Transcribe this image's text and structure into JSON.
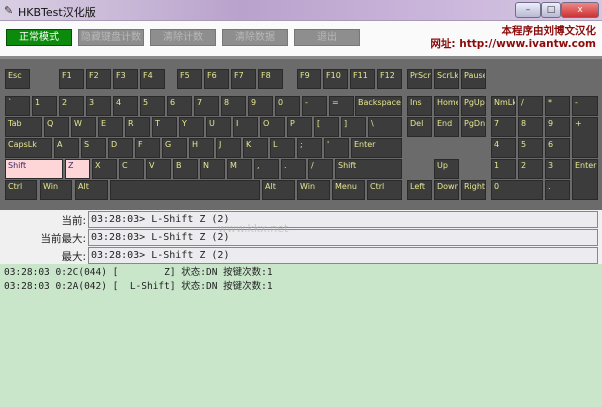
{
  "window": {
    "title": "HKBTest汉化版",
    "minimize": "–",
    "maximize": "□",
    "close": "x"
  },
  "toolbar": {
    "buttons": [
      "正常模式",
      "隐藏键盘计数",
      "清除计数",
      "清除数据",
      "退出"
    ],
    "credit_line1": "本程序由刘博文汉化",
    "credit_line2": "网址: http://www.ivantw.com"
  },
  "keyboard": {
    "pressed": [
      "L-Shift",
      "Z"
    ],
    "rows": [
      [
        "Esc",
        "F1",
        "F2",
        "F3",
        "F4",
        "F5",
        "F6",
        "F7",
        "F8",
        "F9",
        "F10",
        "F11",
        "F12",
        "PrScr",
        "ScrLk",
        "Pause"
      ],
      [
        "`",
        "1",
        "2",
        "3",
        "4",
        "5",
        "6",
        "7",
        "8",
        "9",
        "0",
        "-",
        "=",
        "Backspace",
        "Ins",
        "Home",
        "PgUp",
        "NmLk",
        "/",
        "*",
        "-"
      ],
      [
        "Tab",
        "Q",
        "W",
        "E",
        "R",
        "T",
        "Y",
        "U",
        "I",
        "O",
        "P",
        "[",
        "]",
        "\\",
        "Del",
        "End",
        "PgDn",
        "7",
        "8",
        "9",
        "+"
      ],
      [
        "CapsLk",
        "A",
        "S",
        "D",
        "F",
        "G",
        "H",
        "J",
        "K",
        "L",
        ";",
        "'",
        "Enter",
        "4",
        "5",
        "6"
      ],
      [
        "Shift",
        "Z",
        "X",
        "C",
        "V",
        "B",
        "N",
        "M",
        ",",
        ".",
        "/",
        "Shift",
        "Up",
        "1",
        "2",
        "3",
        "Enter"
      ],
      [
        "Ctrl",
        "Win",
        "Alt",
        "",
        "Alt",
        "Win",
        "Menu",
        "Ctrl",
        "Left",
        "Down",
        "Right",
        "0",
        "."
      ]
    ]
  },
  "status": {
    "rows": [
      {
        "label": "当前:",
        "value": "03:28:03> L-Shift Z (2)"
      },
      {
        "label": "当前最大:",
        "value": "03:28:03> L-Shift Z (2)"
      },
      {
        "label": "最大:",
        "value": "03:28:03> L-Shift Z (2)"
      }
    ]
  },
  "watermark": "www.kkx.net",
  "log": [
    "03:28:03 0:2C(044) [        Z] 状态:DN 按键次数:1",
    "03:28:03 0:2A(042) [  L-Shift] 状态:DN 按键次数:1"
  ],
  "colors": {
    "key_bg": "#3c3c3c",
    "key_text": "#e8e890",
    "key_pressed": "#ffd6d8",
    "active_button": "#0c8a0c",
    "log_bg": "#c9e6cb"
  }
}
